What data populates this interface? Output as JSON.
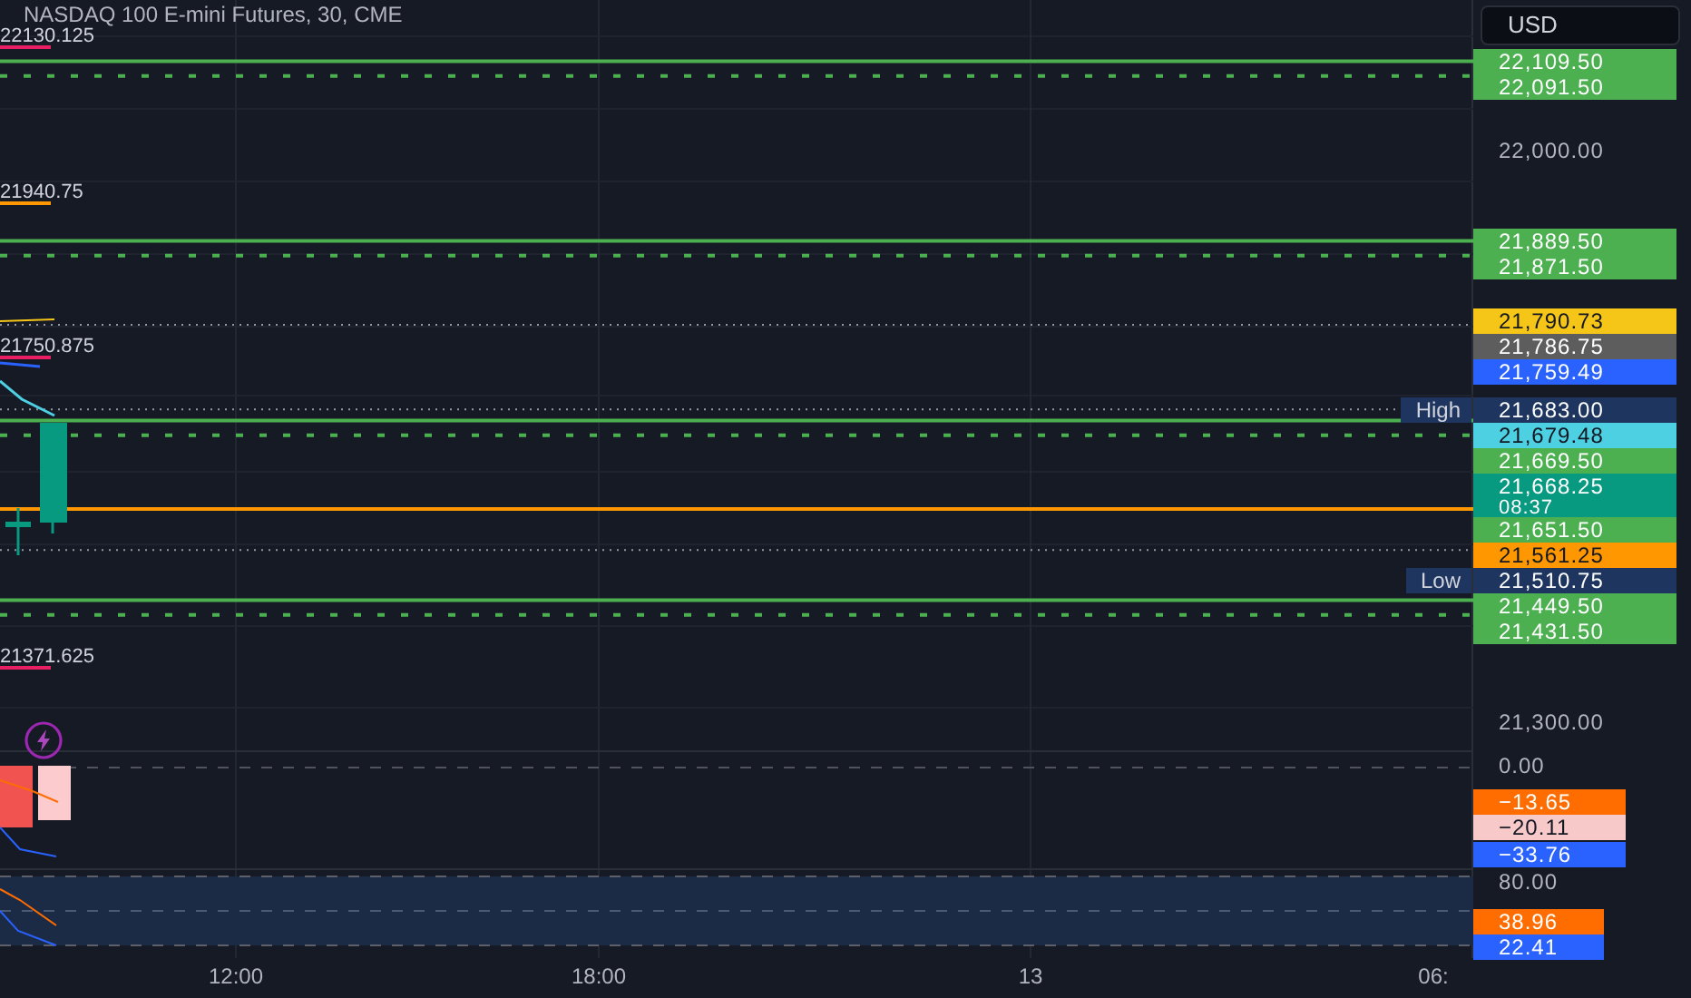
{
  "title": "NASDAQ 100 E-mini Futures, 30, CME",
  "currency": "USD",
  "price_ticks": [
    "22,000.00",
    "21,300.00"
  ],
  "price_tags": [
    {
      "text": "22,109.50",
      "color": "#4caf50",
      "kind": "solid"
    },
    {
      "text": "22,091.50",
      "color": "#4caf50",
      "kind": "dashed"
    },
    {
      "text": "21,889.50",
      "color": "#4caf50",
      "kind": "solid"
    },
    {
      "text": "21,871.50",
      "color": "#4caf50",
      "kind": "dashed"
    },
    {
      "text": "21,790.73",
      "color": "#f5c518",
      "kind": "tag"
    },
    {
      "text": "21,786.75",
      "color": "#5d5d5d",
      "kind": "dotted"
    },
    {
      "text": "21,759.49",
      "color": "#2962ff",
      "kind": "tag"
    },
    {
      "text": "21,683.00",
      "color": "#1e3560",
      "kind": "dotted",
      "side_label": "High"
    },
    {
      "text": "21,679.48",
      "color": "#4dd0e1",
      "kind": "tag"
    },
    {
      "text": "21,669.50",
      "color": "#4caf50",
      "kind": "solid"
    },
    {
      "text": "21,668.25",
      "color": "#089981",
      "kind": "tag",
      "countdown": "08:37"
    },
    {
      "text": "21,651.50",
      "color": "#4caf50",
      "kind": "dashed"
    },
    {
      "text": "21,561.25",
      "color": "#ff9800",
      "kind": "solid"
    },
    {
      "text": "21,510.75",
      "color": "#1e3560",
      "kind": "dotted",
      "side_label": "Low"
    },
    {
      "text": "21,449.50",
      "color": "#4caf50",
      "kind": "solid"
    },
    {
      "text": "21,431.50",
      "color": "#4caf50",
      "kind": "dashed"
    }
  ],
  "left_labels": [
    {
      "text": "22130.125",
      "color": "#e91e63"
    },
    {
      "text": "21940.75",
      "color": "#ff9800"
    },
    {
      "text": "21750.875",
      "color": "#e91e63"
    },
    {
      "text": "21371.625",
      "color": "#e91e63"
    }
  ],
  "pane_1": {
    "ticks": [
      "0.00"
    ],
    "tags": [
      {
        "text": "−13.65",
        "color": "#ff6d00"
      },
      {
        "text": "−20.11",
        "color": "#f8c9c9"
      },
      {
        "text": "−33.76",
        "color": "#2962ff"
      }
    ]
  },
  "pane_2": {
    "ticks": [
      "80.00"
    ],
    "tags": [
      {
        "text": "38.96",
        "color": "#ff6d00"
      },
      {
        "text": "22.41",
        "color": "#2962ff"
      }
    ]
  },
  "time_axis": [
    "12:00",
    "18:00",
    "13",
    "06:"
  ]
}
